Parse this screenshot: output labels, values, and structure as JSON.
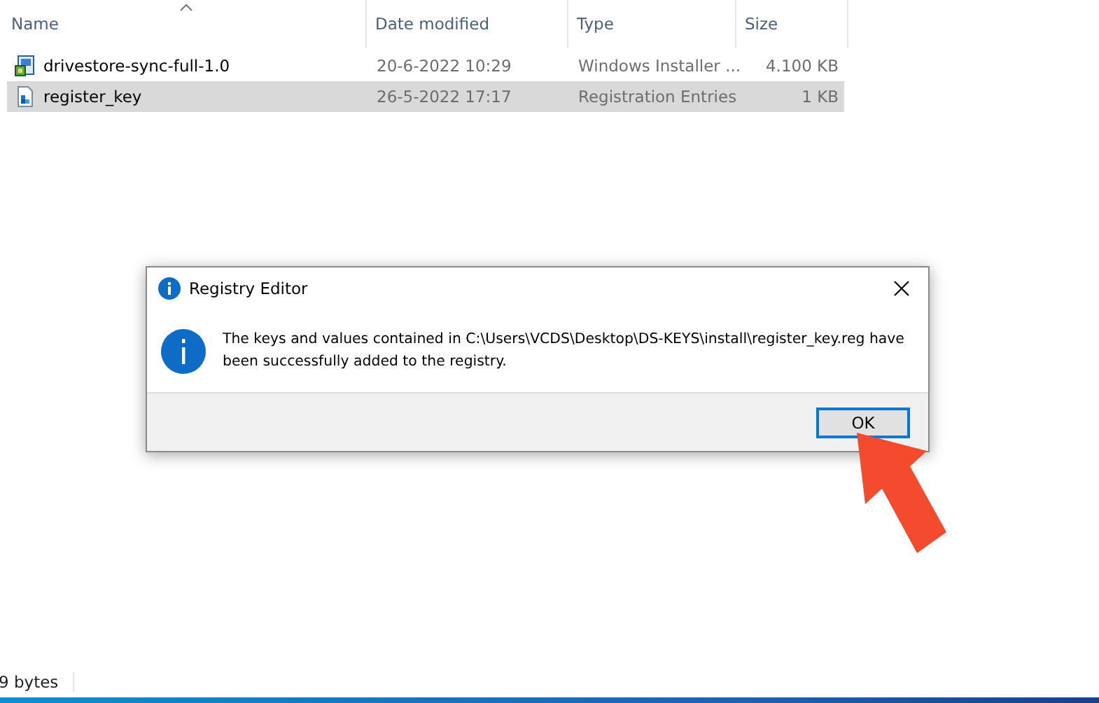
{
  "file_list": {
    "columns": [
      {
        "label": "Name",
        "sorted": true
      },
      {
        "label": "Date modified",
        "sorted": false
      },
      {
        "label": "Type",
        "sorted": false
      },
      {
        "label": "Size",
        "sorted": false
      }
    ],
    "rows": [
      {
        "kind": "installer",
        "name": "drivestore-sync-full-1.0",
        "date": "20-6-2022 10:29",
        "type": "Windows Installer ...",
        "size": "4.100 KB",
        "selected": false
      },
      {
        "kind": "registry",
        "name": "register_key",
        "date": "26-5-2022 17:17",
        "type": "Registration Entries",
        "size": "1 KB",
        "selected": true
      }
    ]
  },
  "dialog": {
    "title": "Registry Editor",
    "message": "The keys and values contained in C:\\Users\\VCDS\\Desktop\\DS-KEYS\\install\\register_key.reg have been successfully added to the registry.",
    "buttons": [
      {
        "label": "OK",
        "focused": true
      }
    ]
  },
  "status_bar": {
    "text": "9 bytes"
  }
}
